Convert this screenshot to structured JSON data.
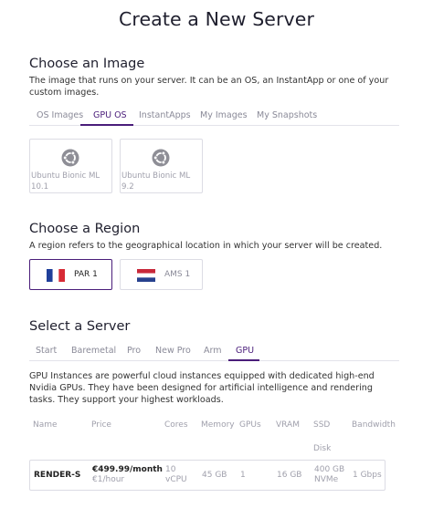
{
  "page_title": "Create a New Server",
  "image_section": {
    "title": "Choose an Image",
    "description": "The image that runs on your server. It can be an OS, an InstantApp or one of your custom images.",
    "tabs": [
      {
        "label": "OS Images",
        "active": false
      },
      {
        "label": "GPU OS",
        "active": true
      },
      {
        "label": "InstantApps",
        "active": false
      },
      {
        "label": "My Images",
        "active": false
      },
      {
        "label": "My Snapshots",
        "active": false
      }
    ],
    "cards": [
      {
        "name": "Ubuntu Bionic ML",
        "version": "10.1",
        "icon": "ubuntu-icon"
      },
      {
        "name": "Ubuntu Bionic ML",
        "version": "9.2",
        "icon": "ubuntu-icon"
      }
    ]
  },
  "region_section": {
    "title": "Choose a Region",
    "description": "A region refers to the geographical location in which your server will be created.",
    "regions": [
      {
        "code": "PAR 1",
        "flag": "france-flag-icon",
        "selected": true
      },
      {
        "code": "AMS 1",
        "flag": "netherlands-flag-icon",
        "selected": false
      }
    ]
  },
  "server_section": {
    "title": "Select a Server",
    "tabs": [
      {
        "label": "Start",
        "active": false
      },
      {
        "label": "Baremetal",
        "active": false
      },
      {
        "label": "Pro",
        "active": false
      },
      {
        "label": "New Pro",
        "active": false
      },
      {
        "label": "Arm",
        "active": false
      },
      {
        "label": "GPU",
        "active": true
      }
    ],
    "description": "GPU Instances are powerful cloud instances equipped with dedicated high-end Nvidia GPUs. They have been designed for artificial intelligence and rendering tasks. They support your highest workloads.",
    "table": {
      "headers": {
        "name": "Name",
        "price": "Price",
        "cores": "Cores",
        "memory": "Memory",
        "gpus": "GPUs",
        "vram": "VRAM",
        "ssd_line1": "SSD",
        "ssd_line2": "Disk",
        "bandwidth": "Bandwidth"
      },
      "rows": [
        {
          "name": "RENDER-S",
          "price_month": "€499.99/month",
          "price_hour": "€1/hour",
          "cores_line1": "10",
          "cores_line2": "vCPU",
          "memory": "45 GB",
          "gpus": "1",
          "vram": "16 GB",
          "ssd_line1": "400 GB",
          "ssd_line2": "NVMe",
          "bandwidth": "1 Gbps"
        }
      ]
    }
  },
  "colors": {
    "accent": "#4a1d7a",
    "muted_text": "#a0a0ac",
    "border": "#dcdce4"
  }
}
